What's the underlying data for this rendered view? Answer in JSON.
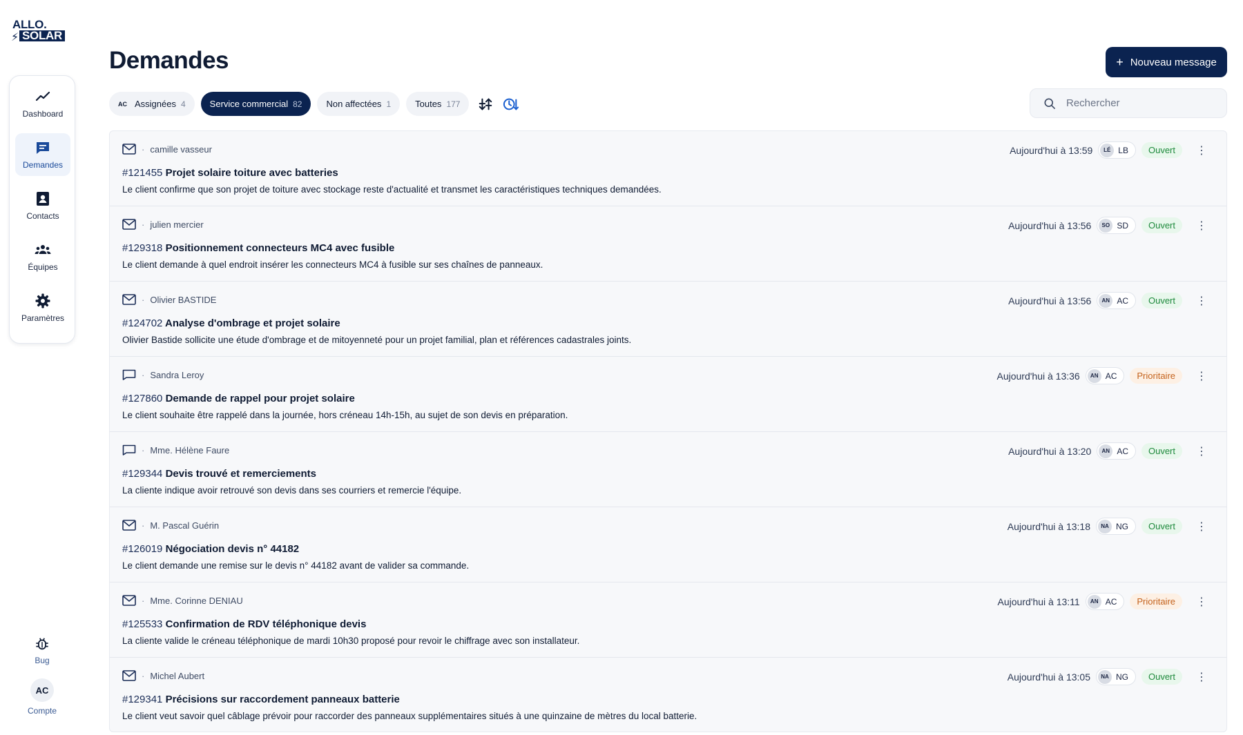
{
  "brand": {
    "logo_line1": "ALLO.",
    "logo_line2": "SOLAR",
    "logo_bolt": "⚡"
  },
  "sidebar": {
    "items": [
      {
        "label": "Dashboard",
        "icon": "trend-icon"
      },
      {
        "label": "Demandes",
        "icon": "chat-icon"
      },
      {
        "label": "Contacts",
        "icon": "contact-card-icon"
      },
      {
        "label": "Équipes",
        "icon": "team-icon"
      },
      {
        "label": "Paramètres",
        "icon": "gear-icon"
      }
    ],
    "bug_label": "Bug",
    "account_initials": "AC",
    "account_label": "Compte"
  },
  "header": {
    "title": "Demandes",
    "new_message_label": "Nouveau message",
    "new_message_plus": "+"
  },
  "filters": [
    {
      "prefix": "AC",
      "label": "Assignées",
      "count": "4"
    },
    {
      "label": "Service commercial",
      "count": "82"
    },
    {
      "label": "Non affectées",
      "count": "1"
    },
    {
      "label": "Toutes",
      "count": "177"
    }
  ],
  "search": {
    "placeholder": "Rechercher"
  },
  "colors": {
    "primary": "#0b2350",
    "open_green": "#1f8a3d",
    "priority_orange": "#c4621c"
  },
  "requests": [
    {
      "channel": "email",
      "sender": "camille vasseur",
      "number": "#121455",
      "title": "Projet solaire toiture avec batteries",
      "description": "Le client confirme que son projet de toiture avec stockage reste d'actualité et transmet les caractéristiques techniques demandées.",
      "time": "Aujourd'hui à 13:59",
      "mini": "LÉ",
      "initials": "LB",
      "status": "Ouvert",
      "status_kind": "open"
    },
    {
      "channel": "email",
      "sender": "julien mercier",
      "number": "#129318",
      "title": "Positionnement connecteurs MC4 avec fusible",
      "description": "Le client demande à quel endroit insérer les connecteurs MC4 à fusible sur ses chaînes de panneaux.",
      "time": "Aujourd'hui à 13:56",
      "mini": "SO",
      "initials": "SD",
      "status": "Ouvert",
      "status_kind": "open"
    },
    {
      "channel": "email",
      "sender": "Olivier BASTIDE",
      "number": "#124702",
      "title": "Analyse d'ombrage et projet solaire",
      "description": "Olivier Bastide sollicite une étude d'ombrage et de mitoyenneté pour un projet familial, plan et références cadastrales joints.",
      "time": "Aujourd'hui à 13:56",
      "mini": "AN",
      "initials": "AC",
      "status": "Ouvert",
      "status_kind": "open"
    },
    {
      "channel": "chat",
      "sender": "Sandra Leroy",
      "number": "#127860",
      "title": "Demande de rappel pour projet solaire",
      "description": "Le client souhaite être rappelé dans la journée, hors créneau 14h-15h, au sujet de son devis en préparation.",
      "time": "Aujourd'hui à 13:36",
      "mini": "AN",
      "initials": "AC",
      "status": "Prioritaire",
      "status_kind": "prio"
    },
    {
      "channel": "chat",
      "sender": "Mme. Hélène Faure",
      "number": "#129344",
      "title": "Devis trouvé et remerciements",
      "description": "La cliente indique avoir retrouvé son devis dans ses courriers et remercie l'équipe.",
      "time": "Aujourd'hui à 13:20",
      "mini": "AN",
      "initials": "AC",
      "status": "Ouvert",
      "status_kind": "open"
    },
    {
      "channel": "email",
      "sender": "M. Pascal Guérin",
      "number": "#126019",
      "title": "Négociation devis n° 44182",
      "description": "Le client demande une remise sur le devis n° 44182 avant de valider sa commande.",
      "time": "Aujourd'hui à 13:18",
      "mini": "NA",
      "initials": "NG",
      "status": "Ouvert",
      "status_kind": "open"
    },
    {
      "channel": "email",
      "sender": "Mme. Corinne DENIAU",
      "number": "#125533",
      "title": "Confirmation de RDV téléphonique devis",
      "description": "La cliente valide le créneau téléphonique de mardi 10h30 proposé pour revoir le chiffrage avec son installateur.",
      "time": "Aujourd'hui à 13:11",
      "mini": "AN",
      "initials": "AC",
      "status": "Prioritaire",
      "status_kind": "prio"
    },
    {
      "channel": "email",
      "sender": "Michel Aubert",
      "number": "#129341",
      "title": "Précisions sur raccordement panneaux batterie",
      "description": "Le client veut savoir quel câblage prévoir pour raccorder des panneaux supplémentaires situés à une quinzaine de mètres du local batterie.",
      "time": "Aujourd'hui à 13:05",
      "mini": "NA",
      "initials": "NG",
      "status": "Ouvert",
      "status_kind": "open"
    }
  ]
}
